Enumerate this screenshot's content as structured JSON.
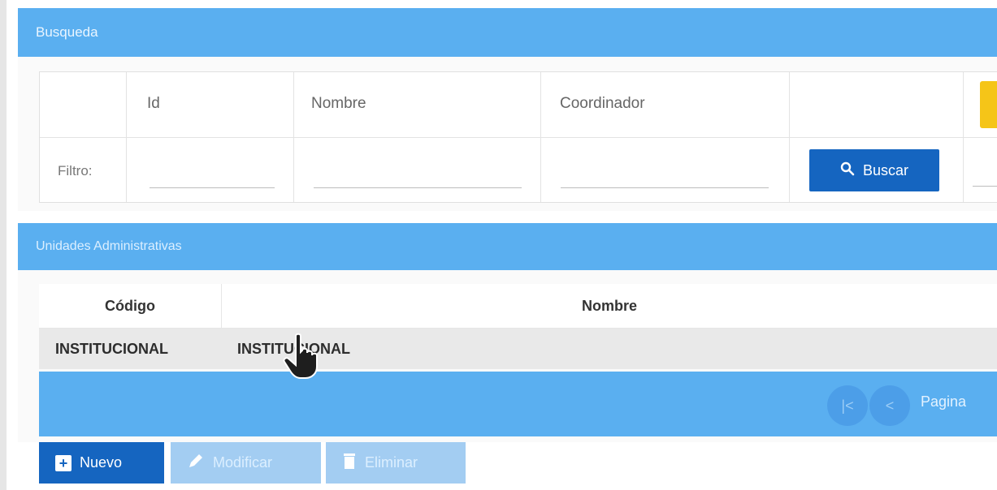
{
  "search_panel": {
    "title": "Busqueda",
    "columns": [
      "Id",
      "Nombre",
      "Coordinador"
    ],
    "filter_label": "Filtro:",
    "filters": {
      "id": "",
      "nombre": "",
      "coordinador": ""
    },
    "search_button_label": "Buscar"
  },
  "units_panel": {
    "title": "Unidades Administrativas",
    "table": {
      "headers": [
        "Código",
        "Nombre"
      ],
      "rows": [
        {
          "codigo": "INSTITUCIONAL",
          "nombre": "INSTITUCIONAL"
        }
      ]
    },
    "pager": {
      "first_label": "|<",
      "prev_label": "<",
      "page_label": "Pagina"
    }
  },
  "toolbar": {
    "new_label": "Nuevo",
    "edit_label": "Modificar",
    "delete_label": "Eliminar"
  },
  "colors": {
    "header_blue": "#5aaff0",
    "primary_button": "#1565c0",
    "disabled_button": "#a3cdf2",
    "accent_yellow": "#f5c518"
  }
}
